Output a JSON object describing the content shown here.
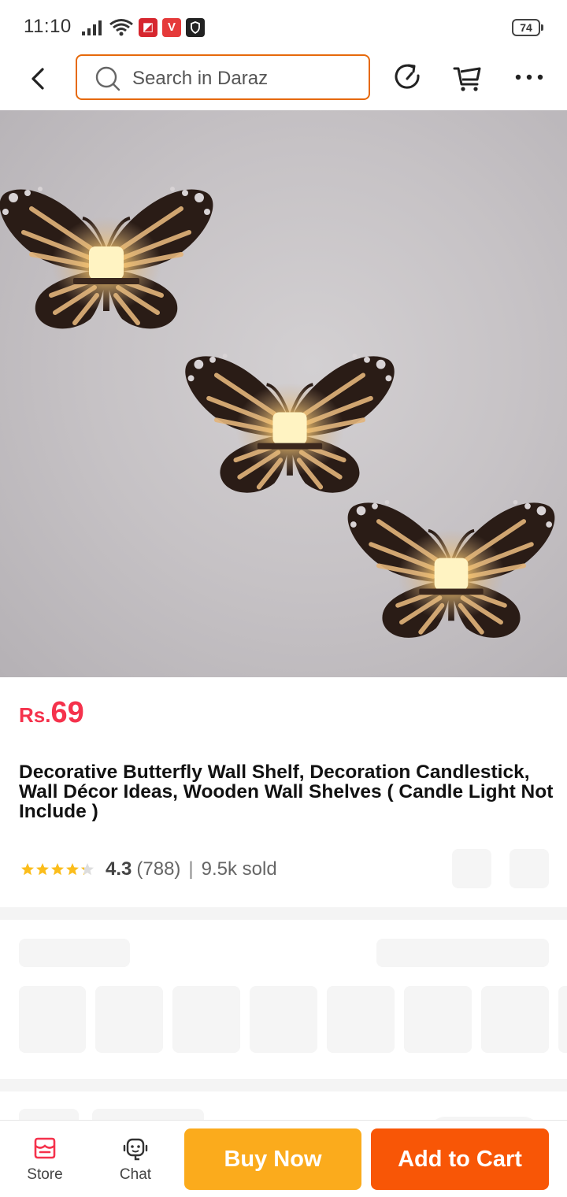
{
  "status_bar": {
    "time": "11:10",
    "battery": "74",
    "notification_icons": [
      "signal-icon",
      "wifi-icon",
      "app-notification-red",
      "v-app-icon",
      "shield-app-icon"
    ]
  },
  "header": {
    "search_placeholder": "Search in Daraz",
    "icons": [
      "back-icon",
      "search-icon",
      "share-icon",
      "cart-icon",
      "more-icon"
    ]
  },
  "product": {
    "image_alt": "Three butterfly wall shelves holding candles",
    "price_currency": "Rs.",
    "price_amount": "69",
    "title": "Decorative Butterfly Wall Shelf, Decoration Candlestick, Wall Décor Ideas, Wooden Wall Shelves ( Candle Light Not Include )",
    "rating_value": "4.3",
    "rating_stars": 4.3,
    "rating_count": "(788)",
    "separator": "|",
    "sold": "9.5k sold"
  },
  "bottom_bar": {
    "store_label": "Store",
    "chat_label": "Chat",
    "buy_now_label": "Buy Now",
    "add_to_cart_label": "Add to Cart"
  },
  "colors": {
    "accent_orange": "#f85606",
    "buy_yellow": "#fbab1c",
    "price_red": "#f5324c",
    "search_border": "#e6690b",
    "star_gold": "#fbbd1b"
  }
}
